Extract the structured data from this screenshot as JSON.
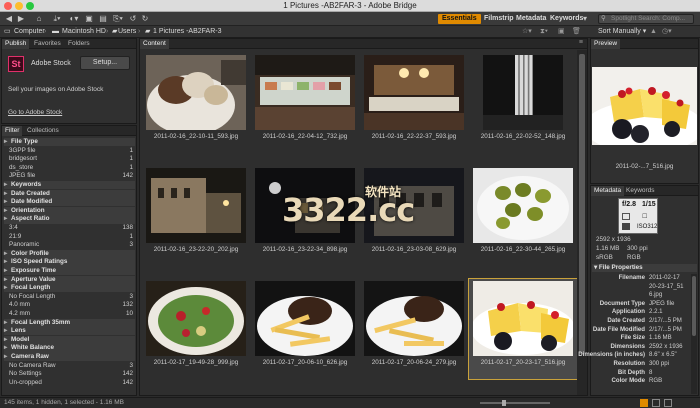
{
  "window": {
    "title": "1 Pictures -AB2FAR-3 - Adobe Bridge"
  },
  "toolbar": {
    "workspaces": [
      "Essentials",
      "Filmstrip",
      "Metadata",
      "Keywords"
    ],
    "search_placeholder": "Spotlight Search: Comp..."
  },
  "path": {
    "items": [
      "Computer",
      "Macintosh HD",
      "Users",
      "1 Pictures -AB2FAR-3"
    ],
    "sort_label": "Sort Manually"
  },
  "left_panel": {
    "tabs": [
      "Publish",
      "Favorites",
      "Folders"
    ],
    "stock_badge": "St",
    "stock_name": "Adobe Stock",
    "setup_button": "Setup...",
    "sell_text": "Sell your images on Adobe Stock",
    "goto_link": "Go to Adobe Stock"
  },
  "filter_panel": {
    "tabs": [
      "Filter",
      "Collections"
    ],
    "rows": [
      {
        "type": "hdr",
        "label": "File Type"
      },
      {
        "type": "val",
        "label": "3GPP file",
        "count": "1"
      },
      {
        "type": "val",
        "label": "bridgesort",
        "count": "1"
      },
      {
        "type": "val",
        "label": "ds_store",
        "count": "1"
      },
      {
        "type": "val",
        "label": "JPEG file",
        "count": "142"
      },
      {
        "type": "hdr",
        "label": "Keywords"
      },
      {
        "type": "hdr",
        "label": "Date Created"
      },
      {
        "type": "hdr",
        "label": "Date Modified"
      },
      {
        "type": "hdr",
        "label": "Orientation"
      },
      {
        "type": "hdr",
        "label": "Aspect Ratio"
      },
      {
        "type": "val",
        "label": "3:4",
        "count": "138"
      },
      {
        "type": "val",
        "label": "21:9",
        "count": "1"
      },
      {
        "type": "val",
        "label": "Panoramic",
        "count": "3"
      },
      {
        "type": "hdr",
        "label": "Color Profile"
      },
      {
        "type": "hdr",
        "label": "ISO Speed Ratings"
      },
      {
        "type": "hdr",
        "label": "Exposure Time"
      },
      {
        "type": "hdr",
        "label": "Aperture Value"
      },
      {
        "type": "hdr",
        "label": "Focal Length"
      },
      {
        "type": "val",
        "label": "No Focal Length",
        "count": "3"
      },
      {
        "type": "val",
        "label": "4.0 mm",
        "count": "132"
      },
      {
        "type": "val",
        "label": "4.2 mm",
        "count": "10"
      },
      {
        "type": "hdr",
        "label": "Focal Length 35mm"
      },
      {
        "type": "hdr",
        "label": "Lens"
      },
      {
        "type": "hdr",
        "label": "Model"
      },
      {
        "type": "hdr",
        "label": "White Balance"
      },
      {
        "type": "hdr",
        "label": "Camera Raw"
      },
      {
        "type": "val",
        "label": "No Camera Raw",
        "count": "3"
      },
      {
        "type": "val",
        "label": "No Settings",
        "count": "142"
      },
      {
        "type": "val",
        "label": "Un-cropped",
        "count": "142"
      }
    ]
  },
  "content": {
    "tab": "Content",
    "thumbs": [
      {
        "caption": "2011-02-16_22-10-11_593.jpg"
      },
      {
        "caption": "2011-02-16_22-04-12_732.jpg"
      },
      {
        "caption": "2011-02-16_22-22-37_593.jpg"
      },
      {
        "caption": "2011-02-16_22-02-52_148.jpg"
      },
      {
        "caption": "2011-02-16_23-22-20_202.jpg"
      },
      {
        "caption": "2011-02-16_23-22-34_898.jpg"
      },
      {
        "caption": "2011-02-16_23-03-08_629.jpg"
      },
      {
        "caption": "2011-02-16_22-30-44_265.jpg"
      },
      {
        "caption": "2011-02-17_19-49-28_999.jpg"
      },
      {
        "caption": "2011-02-17_20-06-10_626.jpg"
      },
      {
        "caption": "2011-02-17_20-06-24_279.jpg"
      },
      {
        "caption": "2011-02-17_20-23-17_516.jpg"
      }
    ],
    "watermark": "3322.cc",
    "watermark_cn": "软件站"
  },
  "preview": {
    "tab": "Preview",
    "caption": "2011-02-...7_516.jpg"
  },
  "metadata_panel": {
    "tabs": [
      "Metadata",
      "Keywords"
    ],
    "exif": {
      "aperture": "f/2.8",
      "shutter": "1/15",
      "iso": "ISO312",
      "dims": "2592 x 1936",
      "size": "1.16 MB",
      "ppi": "300 ppi",
      "colorspace": "sRGB",
      "mode": "RGB"
    },
    "section": "File Properties",
    "rows": [
      {
        "label": "Filename",
        "value": "2011-02-17"
      },
      {
        "label": "",
        "value": "20-23-17_51"
      },
      {
        "label": "",
        "value": "6.jpg"
      },
      {
        "label": "Document Type",
        "value": "JPEG file"
      },
      {
        "label": "Application",
        "value": "2.2.1"
      },
      {
        "label": "Date Created",
        "value": "2/17/...5 PM"
      },
      {
        "label": "Date File Modified",
        "value": "2/17/...5 PM"
      },
      {
        "label": "File Size",
        "value": "1.16 MB"
      },
      {
        "label": "Dimensions",
        "value": "2592 x 1936"
      },
      {
        "label": "Dimensions (in inches)",
        "value": "8.6\" x 6.5\""
      },
      {
        "label": "Resolution",
        "value": "300 ppi"
      },
      {
        "label": "Bit Depth",
        "value": "8"
      },
      {
        "label": "Color Mode",
        "value": "RGB"
      }
    ]
  },
  "status": {
    "text": "145 items, 1 hidden, 1 selected - 1.16 MB"
  },
  "colors": {
    "accent": "#e08a00",
    "selection": "#c9a23b"
  }
}
